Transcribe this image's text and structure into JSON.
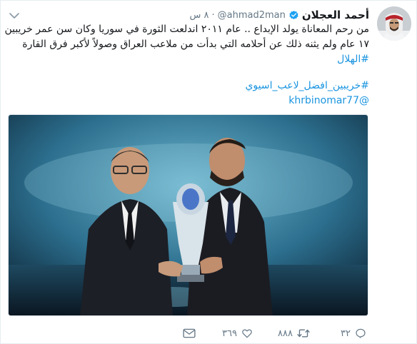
{
  "tweet": {
    "author": {
      "name": "أحمد العجلان",
      "handle": "@ahmad2man",
      "verified": true,
      "avatar_icon": "user-avatar"
    },
    "time": "٨ س",
    "separator": "·",
    "text_lines": [
      "من رحم المعاناة يولد الإبداع .. عام ٢٠١١ اندلعت الثورة في سوريا وكان سن عمر خريبين",
      "١٧ عام ولم يثنه ذلك عن أحلامه التي بدأت من ملاعب العراق وصولاً لأكبر فرق القارة"
    ],
    "hashtags": [
      "#الهلال",
      "#خريبين_افضل_لاعب_اسيوي"
    ],
    "mention": "@khrbinomar77",
    "actions": {
      "reply_count": "٣٢",
      "retweet_count": "٨٨٨",
      "like_count": "٣٦٩",
      "reply_icon": "reply-icon",
      "retweet_icon": "retweet-icon",
      "like_icon": "heart-icon",
      "message_icon": "envelope-icon"
    },
    "colors": {
      "link": "#1b95e0",
      "muted": "#657786",
      "verified": "#1da1f2"
    }
  }
}
